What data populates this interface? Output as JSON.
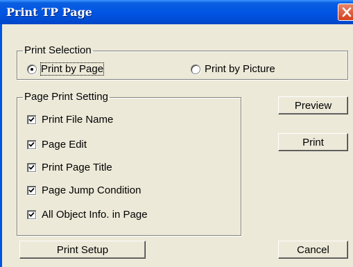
{
  "window": {
    "title": "Print TP Page"
  },
  "print_selection": {
    "legend": "Print Selection",
    "options": [
      {
        "label": "Print by Page",
        "checked": true
      },
      {
        "label": "Print by Picture",
        "checked": false
      }
    ]
  },
  "page_print_setting": {
    "legend": "Page Print Setting",
    "items": [
      {
        "label": "Print File Name",
        "checked": true
      },
      {
        "label": "Page Edit",
        "checked": true
      },
      {
        "label": "Print Page Title",
        "checked": true
      },
      {
        "label": "Page Jump Condition",
        "checked": true
      },
      {
        "label": "All Object Info. in Page",
        "checked": true
      }
    ]
  },
  "buttons": {
    "preview": "Preview",
    "print": "Print",
    "print_setup": "Print Setup",
    "cancel": "Cancel"
  },
  "icons": {
    "close": "close-x-icon"
  },
  "colors": {
    "titlebar": "#0054e3",
    "close_button": "#d33f1c",
    "dialog_bg": "#ece9d8"
  }
}
